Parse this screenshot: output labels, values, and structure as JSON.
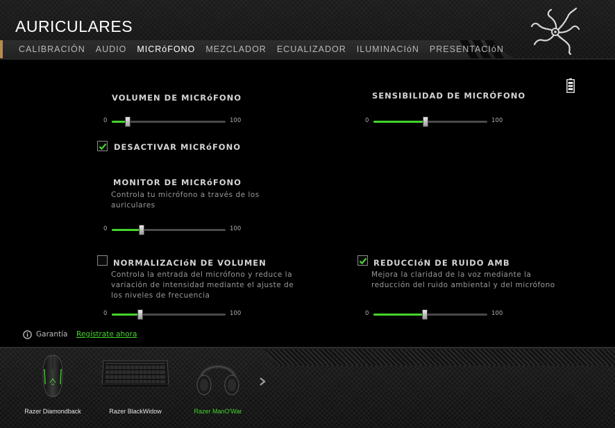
{
  "app": {
    "title": "AURICULARES"
  },
  "tabs": [
    {
      "label": "CALIBRACIÓN",
      "active": false
    },
    {
      "label": "AUDIO",
      "active": false
    },
    {
      "label": "MICRóFONO",
      "active": true
    },
    {
      "label": "MEZCLADOR",
      "active": false
    },
    {
      "label": "ECUALIZADOR",
      "active": false
    },
    {
      "label": "ILUMINACIóN",
      "active": false
    },
    {
      "label": "PRESENTACIóN",
      "active": false
    }
  ],
  "mic_volume": {
    "title": "VOLUMEN DE MICRóFONO",
    "min": "0",
    "max": "100",
    "value": 14
  },
  "mic_sensitivity": {
    "title": "SENSIBILIDAD DE MICRÓFONO",
    "min": "0",
    "max": "100",
    "value": 46
  },
  "mic_mute": {
    "label": "DESACTIVAR MICRóFONO",
    "checked": true
  },
  "mic_monitor": {
    "title": "MONITOR DE MICRóFONO",
    "description_line1": "Controla tu micrófono a través de los",
    "description_line2": "auriculares",
    "min": "0",
    "max": "100",
    "value": 26
  },
  "volume_normalization": {
    "label": "NORMALIZACIóN DE VOLUMEN",
    "checked": false,
    "description_line1": "Controla la entrada del micrófono y reduce la",
    "description_line2": "variación de intensidad mediante el ajuste de",
    "description_line3": "los niveles de frecuencia",
    "min": "0",
    "max": "100",
    "value": 25
  },
  "noise_reduction": {
    "label": "REDUCCIóN DE RUIDO AMBIENTA",
    "checked": true,
    "description_line1": "Mejora la claridad de la voz mediante la",
    "description_line2": "reducción del ruido ambiental y del micrófono",
    "min": "0",
    "max": "100",
    "value": 45
  },
  "warranty": {
    "label": "Garantía",
    "link": "Regístrate ahora"
  },
  "devices": [
    {
      "name": "Razer Diamondback",
      "icon": "mouse-icon",
      "active": false
    },
    {
      "name": "Razer BlackWidow",
      "icon": "keyboard-icon",
      "active": false
    },
    {
      "name": "Razer ManO'War",
      "icon": "headset-icon",
      "active": true
    }
  ],
  "colors": {
    "accent": "#44d62c",
    "background": "#000000",
    "text": "#cfcfcf"
  }
}
